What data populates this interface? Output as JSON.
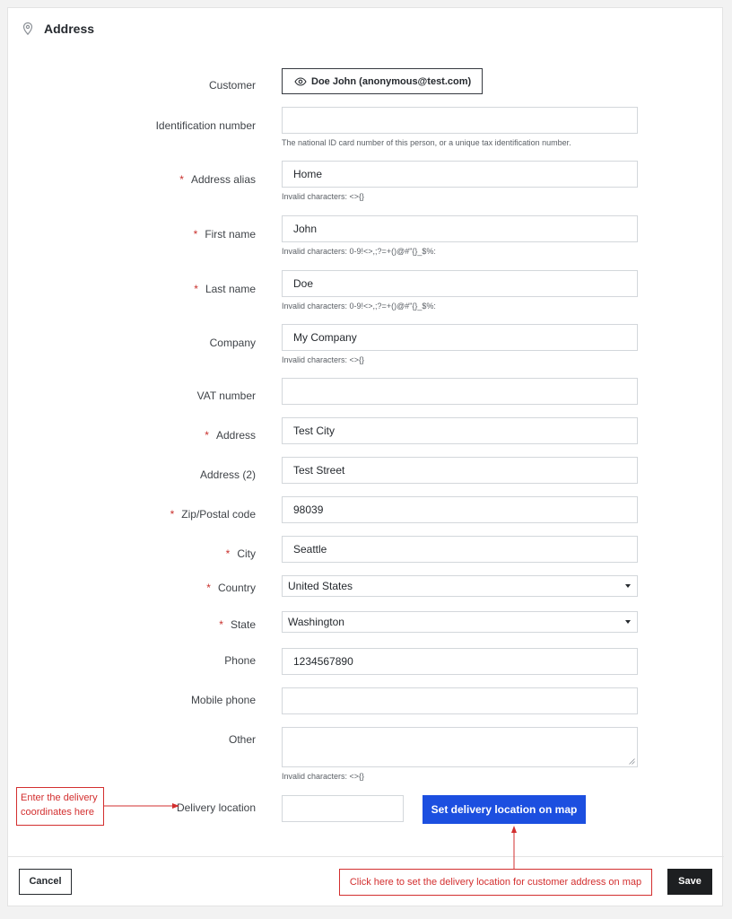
{
  "header": {
    "title": "Address",
    "icon": "map-pin-icon"
  },
  "customer": {
    "label": "Customer",
    "value": "Doe John (anonymous@test.com)",
    "icon": "eye-icon"
  },
  "identification": {
    "label": "Identification number",
    "value": "",
    "help": "The national ID card number of this person, or a unique tax identification number."
  },
  "alias": {
    "label": "Address alias",
    "value": "Home",
    "help": "Invalid characters: <>{}"
  },
  "first_name": {
    "label": "First name",
    "value": "John",
    "help": "Invalid characters: 0-9!<>,;?=+()@#\"{}_$%:"
  },
  "last_name": {
    "label": "Last name",
    "value": "Doe",
    "help": "Invalid characters: 0-9!<>,;?=+()@#\"{}_$%:"
  },
  "company": {
    "label": "Company",
    "value": "My Company",
    "help": "Invalid characters: <>{}"
  },
  "vat": {
    "label": "VAT number",
    "value": ""
  },
  "address1": {
    "label": "Address",
    "value": "Test City"
  },
  "address2": {
    "label": "Address (2)",
    "value": "Test Street"
  },
  "postcode": {
    "label": "Zip/Postal code",
    "value": "98039"
  },
  "city": {
    "label": "City",
    "value": "Seattle"
  },
  "country": {
    "label": "Country",
    "value": "United States"
  },
  "state": {
    "label": "State",
    "value": "Washington"
  },
  "phone": {
    "label": "Phone",
    "value": "1234567890"
  },
  "mobile": {
    "label": "Mobile phone",
    "value": ""
  },
  "other": {
    "label": "Other",
    "value": "",
    "help": "Invalid characters: <>{}"
  },
  "delivery": {
    "label": "Delivery location",
    "value": "",
    "map_button": "Set delivery location on map"
  },
  "required_mark": "*",
  "footer": {
    "cancel": "Cancel",
    "save": "Save"
  },
  "annotations": {
    "left_note": [
      "Enter the delivery",
      "coordinates here"
    ],
    "bottom_note": "Click here to set the delivery location for customer address on map",
    "color": "#d32f2f"
  },
  "colors": {
    "primary": "#1c4fe0",
    "save_bg": "#1d1f21",
    "required": "#c9302c"
  }
}
